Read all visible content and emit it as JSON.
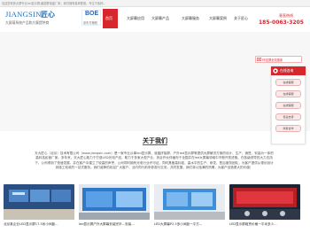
{
  "topbar": {
    "text": "欢迎您来到大屏专业led显示屏,触摸屏液晶厂家，我们拥有各种配置，专注于各种..."
  },
  "header": {
    "logo_latin": "JIANGSIN",
    "logo_cn": "匠心",
    "logo_sub": "大屏幕系统产品和方案提供商",
    "boe_mark": "BOE",
    "boe_sub": "京东方授权"
  },
  "nav": {
    "items": [
      "首页",
      "大屏幕应用",
      "大屏幕产品",
      "大屏幕服务",
      "大屏幕案例",
      "关于匠心"
    ],
    "active_index": 0
  },
  "hotline": {
    "label": "垂直热线",
    "number": "185-0063-3205"
  },
  "search": {
    "text": "PE控屏全站搜索"
  },
  "float_panel": {
    "title": "在线咨询",
    "buttons": [
      "在线客服",
      "在线客服",
      "在线客服",
      "售后支持",
      "商务合作"
    ]
  },
  "about": {
    "title": "关于我们",
    "body": "天大匠心（北京）技术有限公司（www.jiangsin.com）是一家专业从事led显示屏、液晶拼接屏、户外led显示屏等提供大屏解决方案的设计、生产、销售、安装为一体的高科技民营厂家。多年来，天大匠心致力于打造LED光电产品，助力于多家大型产业，其合作伙伴遍布于全国并在led大屏幕领域中不断开拓进取。在各级领导的大力支持下，公司得到了快速发展。并在客户中建立了较高的声誉，公司同时拥有光电行业许可证，同时具备高标准、高水平的生产、研发、售后服务团队，为客户提供从规划设计到施工验收的一站式服务。我们诚挚的欢迎广大客户、业内同行前来参观与交流，共同发展。",
    "body_lines": [
      "天大匠心（北京）技术有限公司（www.jiangsin.com）是一家专业从事led显示屏、液晶拼接屏、户外led显示屏等提供大屏解决方案的设计、生产、销售、安装为一体的",
      "高科技民营厂家。多年来，天大匠心致力于打造LED光电产品，助力于多家大型产业，其合作伙伴遍布于全国并在led大屏幕领域中不断开拓进取。在各级领导的大力支持",
      "下，公司得到了快速发展，并在客户中建立了较高的声誉，公司同时拥有光电行业许可证，同时具备高标准、高水平的生产、研发、售后服务团队，为客户提供从规划设计",
      "到施工验收的一站式服务。我们诚挚的欢迎广大客户、业内同行前来参观与交流，共同发展，我们将以饱满的热情，为客户创造更大的价值！"
    ]
  },
  "gallery": [
    {
      "caption": "北京某企业LED显示屏17.5米小间距..."
    },
    {
      "caption": "led显示屏户外大屏幕安装完毕...安装..."
    },
    {
      "caption": "LED大屏幕P2.5多小间距一平方..."
    },
    {
      "caption": "LED显示屏租赁价格一平米多少..."
    }
  ],
  "colors": {
    "brand_red": "#d8262d",
    "brand_blue": "#1d6fb8"
  }
}
